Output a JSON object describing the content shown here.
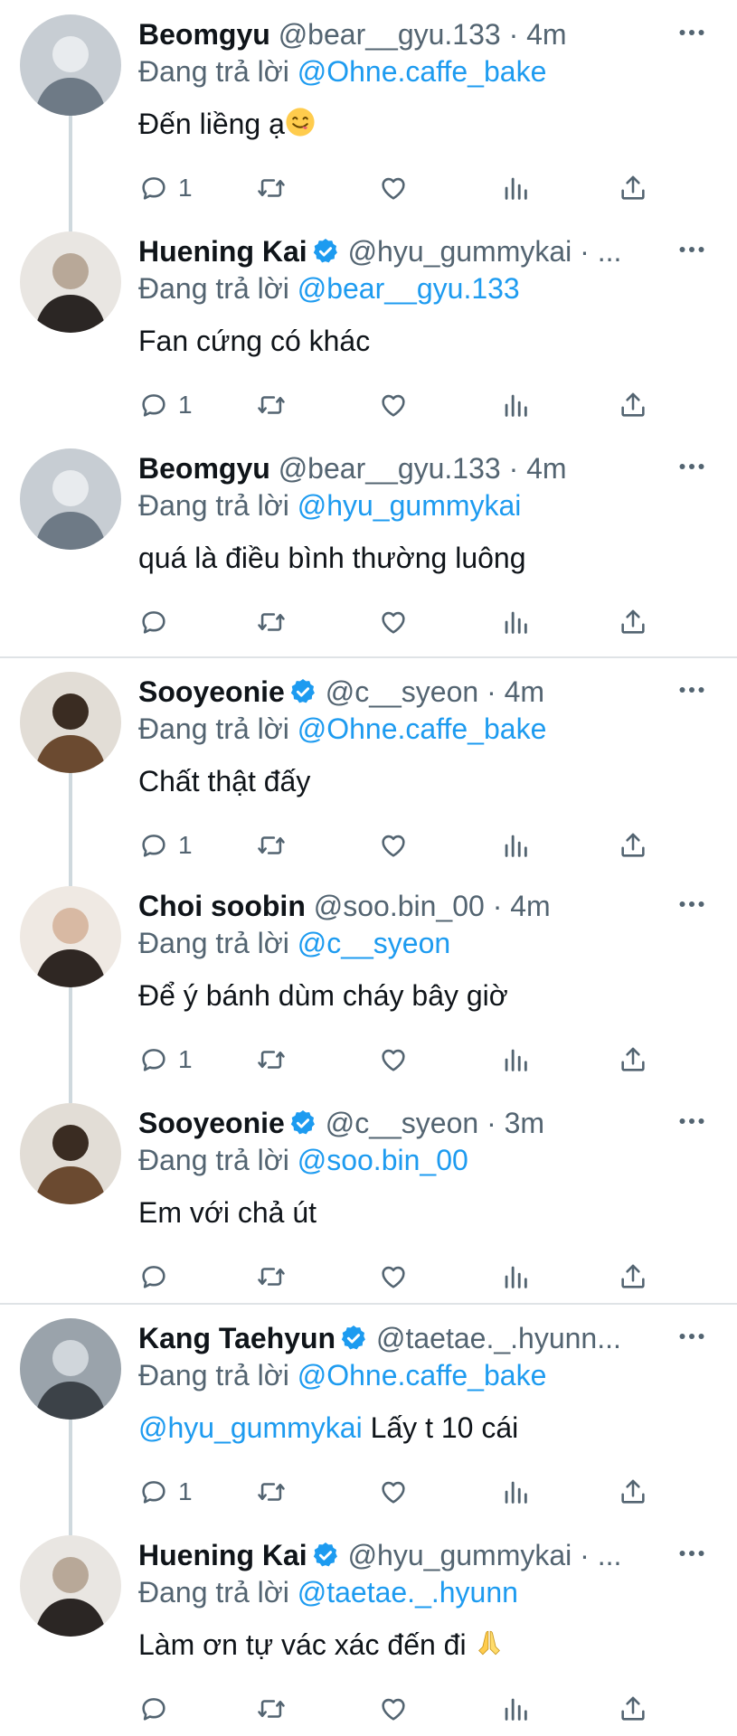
{
  "replying_prefix": "Đang trả lời",
  "colors": {
    "accent": "#1d9bf0",
    "secondary_text": "#536471",
    "primary_text": "#0f1419",
    "thread_line": "#cfd9de"
  },
  "tweets": [
    {
      "name": "Beomgyu",
      "verified": false,
      "handle": "@bear__gyu.133",
      "dot": "·",
      "time": "4m",
      "replying_to": "@Ohne.caffe_bake",
      "body": "Đến liềng ạ",
      "body_mention": "",
      "emoji": "grinning-tongue-emoji",
      "reply_count": "1"
    },
    {
      "name": "Huening Kai",
      "verified": true,
      "handle": "@hyu_gummykai",
      "dot": "·",
      "time": "...",
      "replying_to": "@bear__gyu.133",
      "body": "Fan cứng có khác",
      "body_mention": "",
      "emoji": "",
      "reply_count": "1"
    },
    {
      "name": "Beomgyu",
      "verified": false,
      "handle": "@bear__gyu.133",
      "dot": "·",
      "time": "4m",
      "replying_to": "@hyu_gummykai",
      "body": "quá là điều bình thường luông",
      "body_mention": "",
      "emoji": "",
      "reply_count": ""
    },
    {
      "name": "Sooyeonie",
      "verified": true,
      "handle": "@c__syeon",
      "dot": "·",
      "time": "4m",
      "replying_to": "@Ohne.caffe_bake",
      "body": "Chất thật đấy",
      "body_mention": "",
      "emoji": "",
      "reply_count": "1"
    },
    {
      "name": "Choi soobin",
      "verified": false,
      "handle": "@soo.bin_00",
      "dot": "·",
      "time": "4m",
      "replying_to": "@c__syeon",
      "body": "Để ý bánh dùm cháy bây giờ",
      "body_mention": "",
      "emoji": "",
      "reply_count": "1"
    },
    {
      "name": "Sooyeonie",
      "verified": true,
      "handle": "@c__syeon",
      "dot": "·",
      "time": "3m",
      "replying_to": "@soo.bin_00",
      "body": "Em với chả út",
      "body_mention": "",
      "emoji": "",
      "reply_count": ""
    },
    {
      "name": "Kang Taehyun",
      "verified": true,
      "handle": "@taetae._.hyunn...",
      "dot": "",
      "time": "",
      "replying_to": "@Ohne.caffe_bake",
      "body": " Lấy t 10 cái",
      "body_mention": "@hyu_gummykai",
      "emoji": "",
      "reply_count": "1"
    },
    {
      "name": "Huening Kai",
      "verified": true,
      "handle": "@hyu_gummykai",
      "dot": "·",
      "time": "...",
      "replying_to": "@taetae._.hyunn",
      "body": "Làm ơn tự vác xác đến đi ",
      "body_mention": "",
      "emoji": "folded-hands-emoji",
      "reply_count": ""
    }
  ]
}
